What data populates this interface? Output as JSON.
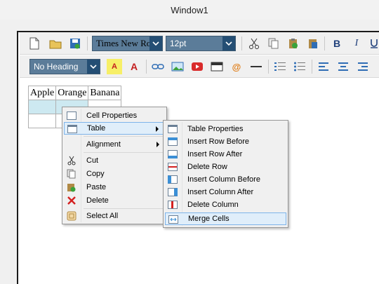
{
  "window": {
    "title": "Window1"
  },
  "toolbar": {
    "font_family": "Times New Roman",
    "font_size": "12pt",
    "heading": "No Heading",
    "bold_label": "B",
    "italic_label": "I",
    "highlight_label": "A",
    "font_color_label": "A",
    "at_label": "@"
  },
  "document": {
    "table": [
      [
        "Apple",
        "Orange",
        "Banana"
      ],
      [
        "",
        "",
        ""
      ],
      [
        "",
        "",
        ""
      ]
    ]
  },
  "context_menu": {
    "items": [
      {
        "label": "Cell Properties",
        "icon": "cell-properties-icon"
      },
      {
        "label": "Table",
        "icon": "table-icon",
        "submenu": true
      },
      {
        "label": "Alignment",
        "submenu": true
      },
      {
        "label": "Cut",
        "icon": "cut-icon"
      },
      {
        "label": "Copy",
        "icon": "copy-icon"
      },
      {
        "label": "Paste",
        "icon": "paste-icon"
      },
      {
        "label": "Delete",
        "icon": "delete-icon"
      },
      {
        "label": "Select All",
        "icon": "select-all-icon"
      }
    ]
  },
  "table_submenu": {
    "items": [
      {
        "label": "Table Properties"
      },
      {
        "label": "Insert Row Before"
      },
      {
        "label": "Insert Row After"
      },
      {
        "label": "Delete Row"
      },
      {
        "label": "Insert Column Before"
      },
      {
        "label": "Insert Column After"
      },
      {
        "label": "Delete Column"
      },
      {
        "label": "Merge Cells"
      }
    ]
  },
  "colors": {
    "selection": "#cde9f1",
    "menu_highlight": "#e0eefa",
    "menu_highlight_border": "#7eb4ea"
  }
}
